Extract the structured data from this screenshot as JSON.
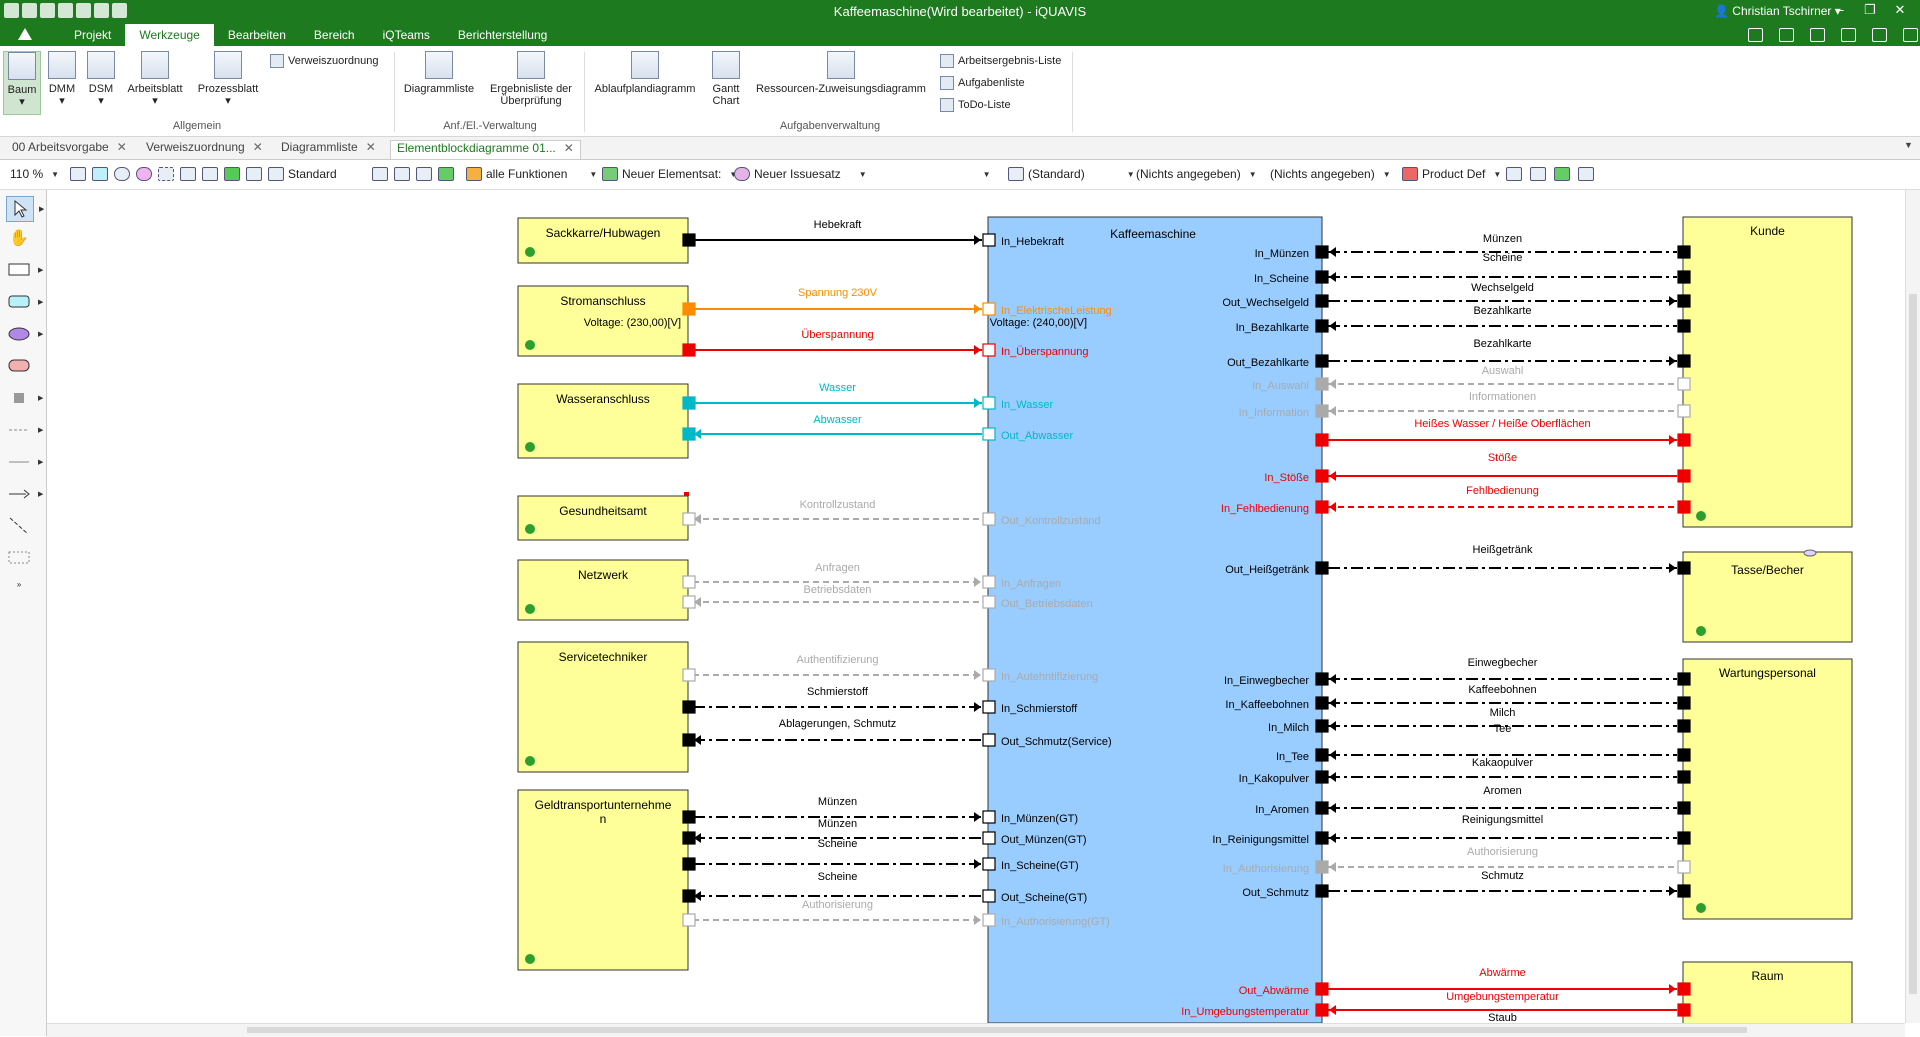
{
  "window": {
    "title": "Kaffeemaschine(Wird bearbeitet) - iQUAVIS",
    "user": "Christian Tschirner"
  },
  "menu_tabs": [
    "Projekt",
    "Werkzeuge",
    "Bearbeiten",
    "Bereich",
    "iQTeams",
    "Berichterstellung"
  ],
  "active_menu_tab": "Werkzeuge",
  "ribbon": {
    "allgemein": {
      "group_label": "Allgemein",
      "baum": "Baum",
      "dmm": "DMM",
      "dsm": "DSM",
      "arbeitsblatt": "Arbeitsblatt",
      "prozessblatt": "Prozessblatt",
      "verweiszuordnung": "Verweiszuordnung"
    },
    "anf": {
      "group_label": "Anf./El.-Verwaltung",
      "diagrammliste": "Diagrammliste",
      "ergebnisliste_1": "Ergebnisliste der",
      "ergebnisliste_2": "Überprüfung"
    },
    "aufgaben": {
      "group_label": "Aufgabenverwaltung",
      "ablaufplan": "Ablaufplandiagramm",
      "gantt_1": "Gantt",
      "gantt_2": "Chart",
      "ressourcen": "Ressourcen-Zuweisungsdiagramm",
      "arbeitsergebnis": "Arbeitsergebnis-Liste",
      "aufgabenliste": "Aufgabenliste",
      "todo": "ToDo-Liste"
    }
  },
  "doc_tabs": [
    {
      "label": "00 Arbeitsvorgabe"
    },
    {
      "label": "Verweiszuordnung"
    },
    {
      "label": "Diagrammliste"
    },
    {
      "label": "Elementblockdiagramme 01..."
    }
  ],
  "toolbar": {
    "zoom": "110 %",
    "line_style": "Standard",
    "functions": "alle Funktionen",
    "elementsatz": "Neuer Elementsat:",
    "issuesatz": "Neuer Issuesatz",
    "standard_paren": "(Standard)",
    "nichts_1": "(Nichts angegeben)",
    "nichts_2": "(Nichts angegeben)",
    "product_def": "Product Def"
  },
  "colors": {
    "green": "#1e7a1e",
    "block_yellow": "#ffff99",
    "main_blue": "#99ccff",
    "orange": "#ff8c00",
    "red": "#ee0000",
    "cyan": "#00b8c8",
    "gray": "#aaaaaa",
    "black": "#000000"
  },
  "diagram": {
    "center_title": "Kaffeemaschine",
    "left_blocks": [
      "Sackkarre/Hubwagen",
      "Stromanschluss",
      "Wasseranschluss",
      "Gesundheitsamt",
      "Netzwerk",
      "Servicetechniker",
      "Geldtransportunternehme",
      "n"
    ],
    "right_blocks": [
      "Kunde",
      "Tasse/Becher",
      "Wartungspersonal",
      "Raum"
    ],
    "left_flows": [
      "Hebekraft",
      "Spannung 230V",
      "Überspannung",
      "Wasser",
      "Abwasser",
      "Kontrollzustand",
      "Anfragen",
      "Betriebsdaten",
      "Authentifizierung",
      "Schmierstoff",
      "Ablagerungen, Schmutz",
      "Münzen",
      "Münzen",
      "Scheine",
      "Scheine",
      "Authorisierung"
    ],
    "left_ports": [
      "In_Hebekraft",
      "In_ElektrischeLeistung",
      "In_Überspannung",
      "In_Wasser",
      "Out_Abwasser",
      "Out_Kontrollzustand",
      "In_Anfragen",
      "Out_Betriebsdaten",
      "In_Autehntifizierung",
      "In_Schmierstoff",
      "Out_Schmutz(Service)",
      "In_Münzen(GT)",
      "Out_Münzen(GT)",
      "In_Scheine(GT)",
      "Out_Scheine(GT)",
      "In_Authorisierung(GT)"
    ],
    "voltage_labels": [
      "Voltage: (230,00)[V]",
      "Voltage: (240,00)[V]"
    ],
    "right_ports": [
      "In_Münzen",
      "In_Scheine",
      "Out_Wechselgeld",
      "In_Bezahlkarte",
      "Out_Bezahlkarte",
      "In_Auswahl",
      "In_Information",
      "In_Stöße",
      "In_Fehlbedienung",
      "Out_Heißgetränk",
      "In_Einwegbecher",
      "In_Kaffeebohnen",
      "In_Milch",
      "In_Tee",
      "In_Kakopulver",
      "In_Aromen",
      "In_Reinigungsmittel",
      "In_Authorisierung",
      "Out_Schmutz",
      "Out_Abwärme",
      "In_Umgebungstemperatur"
    ],
    "right_flows": [
      "Münzen",
      "Scheine",
      "Wechselgeld",
      "Bezahlkarte",
      "Bezahlkarte",
      "Auswahl",
      "Informationen",
      "Heißes Wasser / Heiße Oberflächen",
      "Stöße",
      "Fehlbedienung",
      "Heißgetränk",
      "Einwegbecher",
      "Kaffeebohnen",
      "Milch",
      "Tee",
      "Kakaopulver",
      "Aromen",
      "Reinigungsmittel",
      "Authorisierung",
      "Schmutz",
      "Abwärme",
      "Umgebungstemperatur",
      "Staub"
    ]
  }
}
